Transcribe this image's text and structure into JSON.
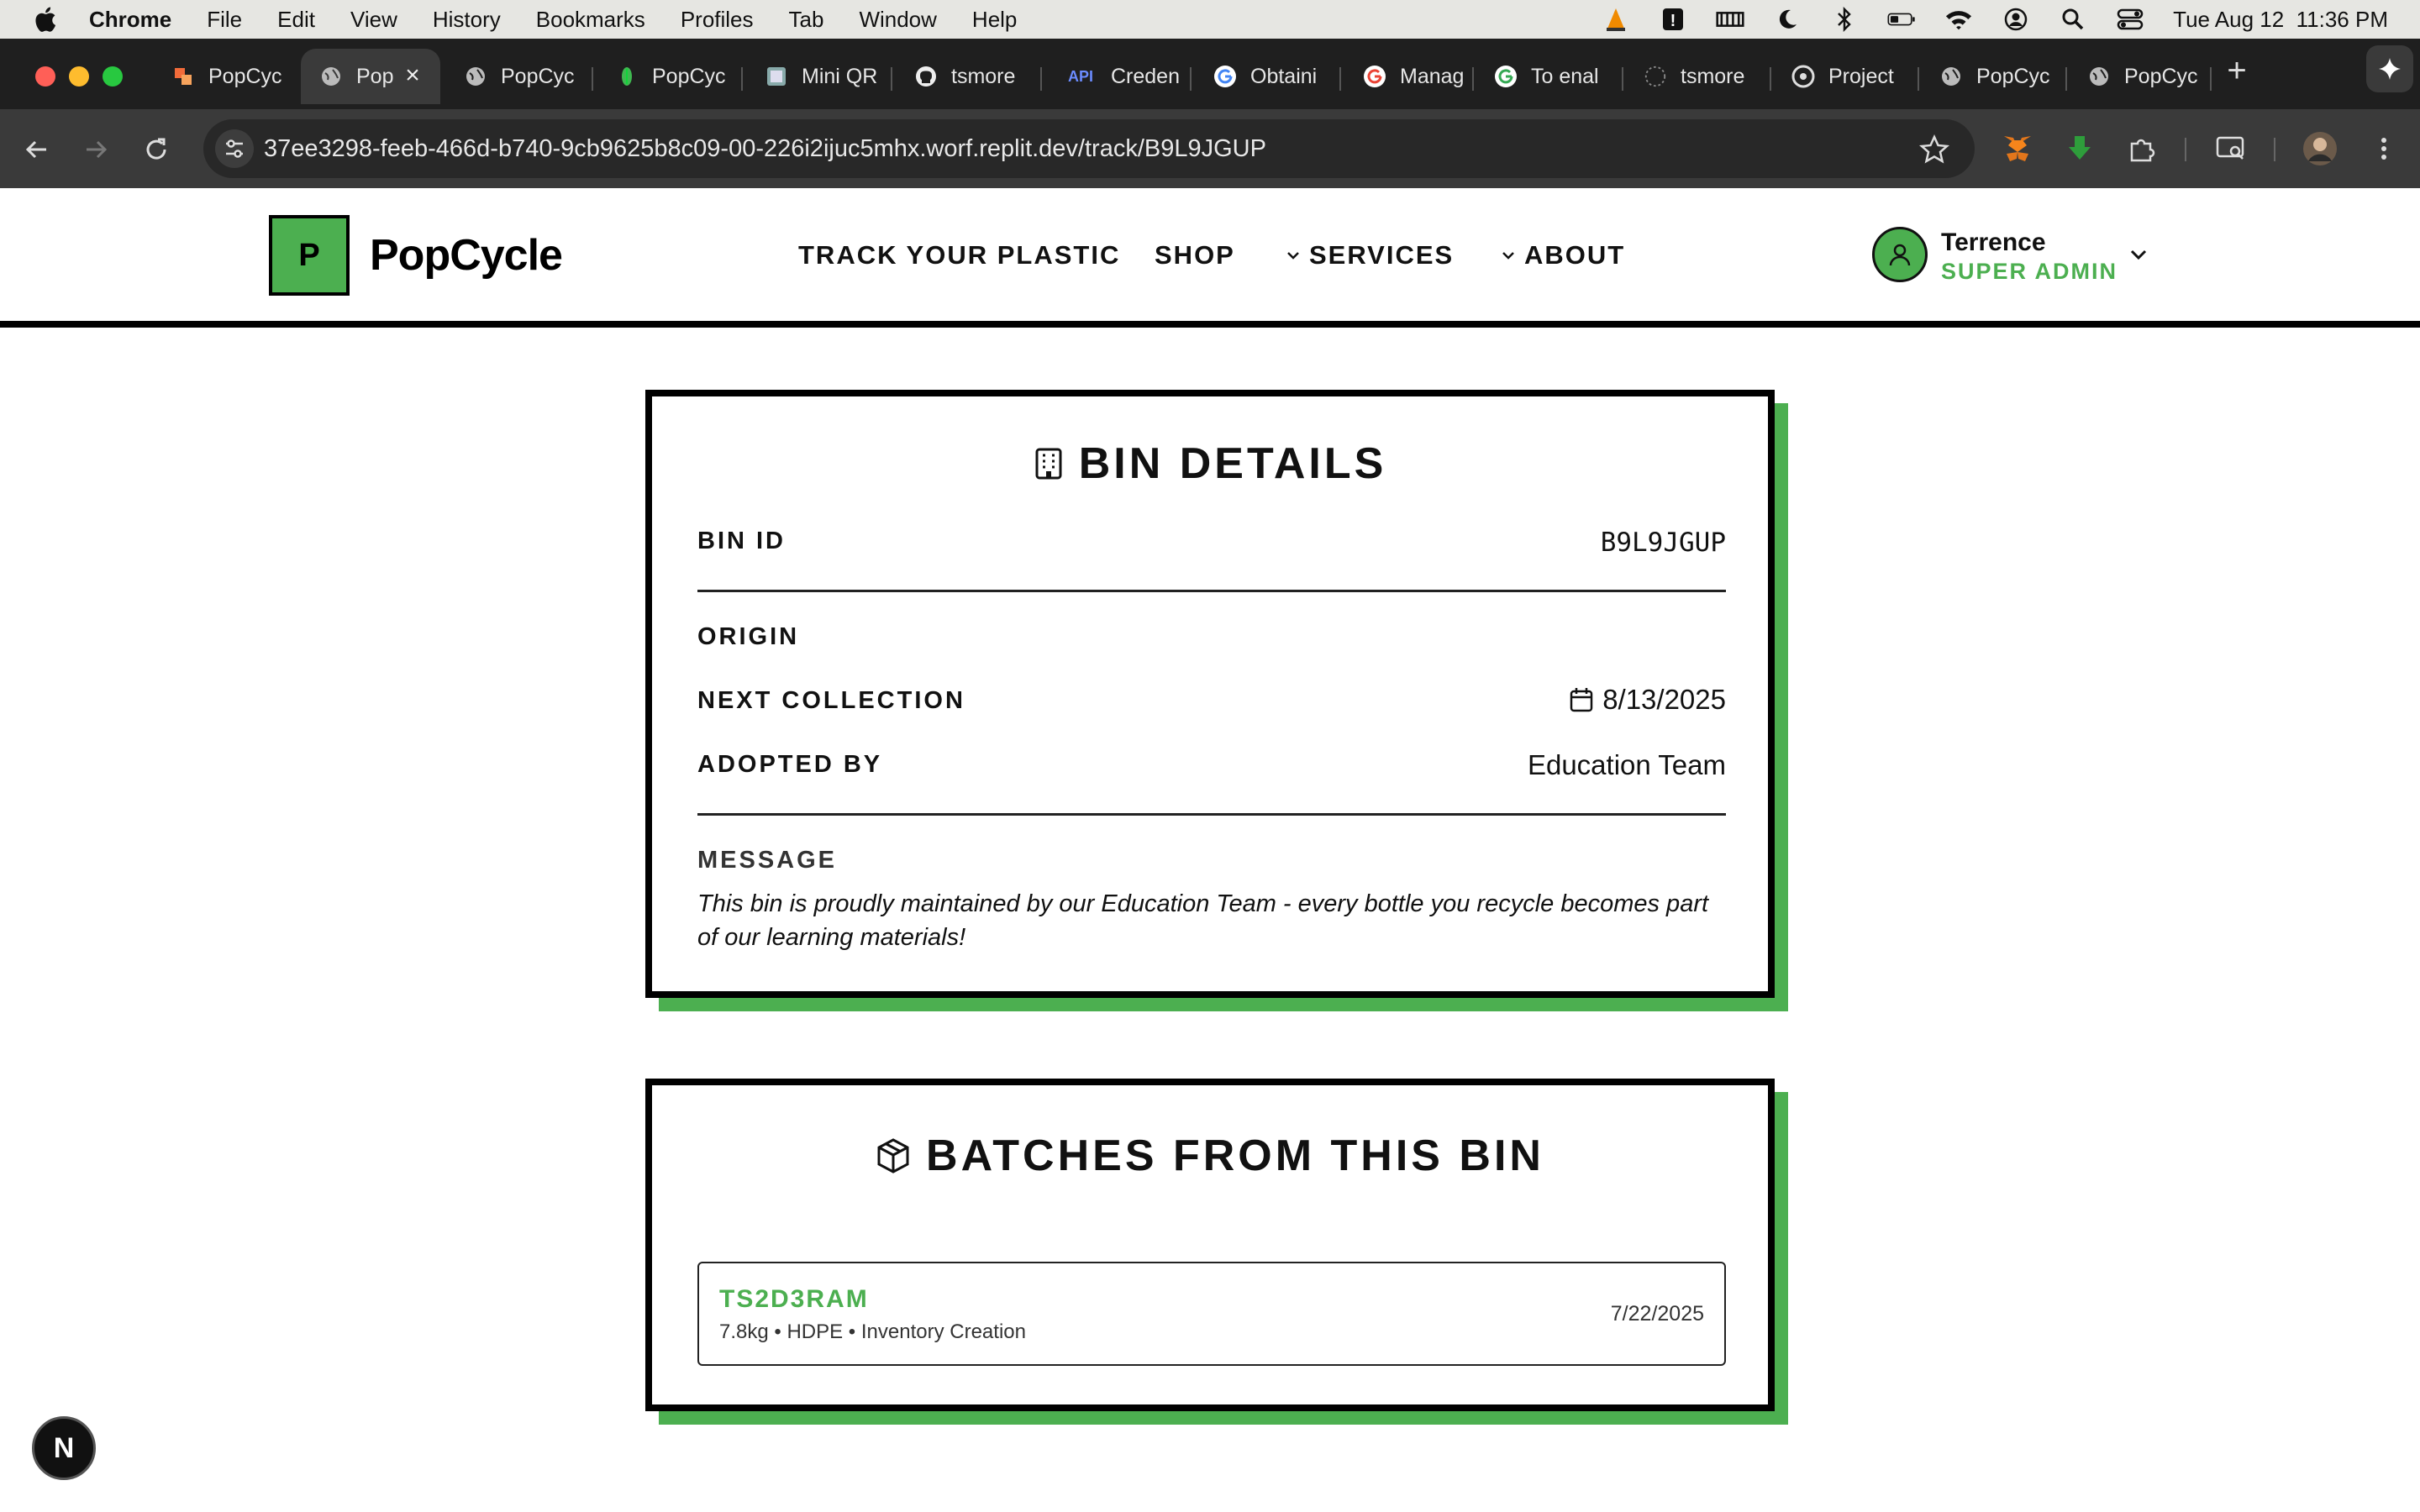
{
  "menubar": {
    "app": "Chrome",
    "items": [
      "File",
      "Edit",
      "View",
      "History",
      "Bookmarks",
      "Profiles",
      "Tab",
      "Window",
      "Help"
    ],
    "clock": "Tue Aug 12  11:36 PM"
  },
  "tabs": [
    {
      "title": "PopCyc",
      "icon": "popcycle-favicon"
    },
    {
      "title": "Pop",
      "icon": "globe-icon",
      "active": true
    },
    {
      "title": "PopCyc",
      "icon": "globe-icon"
    },
    {
      "title": "PopCyc",
      "icon": "leaf-icon"
    },
    {
      "title": "Mini QR",
      "icon": "image-icon"
    },
    {
      "title": "tsmore",
      "icon": "github-icon"
    },
    {
      "title": "Creden",
      "icon": "api-icon"
    },
    {
      "title": "Obtaini",
      "icon": "google-icon"
    },
    {
      "title": "Manag",
      "icon": "google-icon"
    },
    {
      "title": "To enal",
      "icon": "google-icon"
    },
    {
      "title": "tsmore",
      "icon": "loading-icon"
    },
    {
      "title": "Project",
      "icon": "replit-icon"
    },
    {
      "title": "PopCyc",
      "icon": "globe-icon"
    },
    {
      "title": "PopCyc",
      "icon": "globe-icon"
    }
  ],
  "browser": {
    "url": "37ee3298-feeb-466d-b740-9cb9625b8c09-00-226i2ijuc5mhx.worf.replit.dev/track/B9L9JGUP"
  },
  "site": {
    "logo_letter": "P",
    "brand": "PopCycle",
    "nav": [
      "TRACK YOUR PLASTIC",
      "SHOP",
      "SERVICES",
      "ABOUT"
    ],
    "user": {
      "name": "Terrence",
      "role": "SUPER ADMIN"
    }
  },
  "bin": {
    "title": "BIN DETAILS",
    "bin_id_label": "BIN ID",
    "bin_id": "B9L9JGUP",
    "origin_label": "ORIGIN",
    "next_collection_label": "NEXT COLLECTION",
    "next_collection": "8/13/2025",
    "adopted_by_label": "ADOPTED BY",
    "adopted_by": "Education Team",
    "message_label": "MESSAGE",
    "message": "This bin is proudly maintained by our Education Team - every bottle you recycle becomes part of our learning materials!"
  },
  "batches": {
    "title": "BATCHES FROM THIS BIN",
    "items": [
      {
        "id": "TS2D3RAM",
        "meta": "7.8kg • HDPE • Inventory Creation",
        "date": "7/22/2025"
      }
    ]
  },
  "dev_badge": "N",
  "colors": {
    "accent": "#4caf50",
    "border": "#000000"
  }
}
